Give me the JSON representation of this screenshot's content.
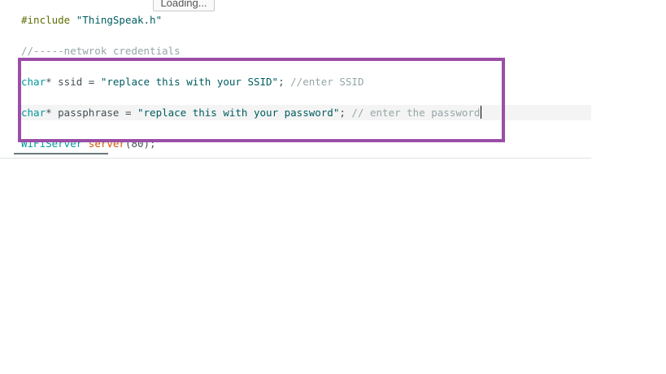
{
  "tooltip": {
    "text": "Loading..."
  },
  "code": {
    "include": {
      "directive": "#include",
      "file": "\"ThingSpeak.h\""
    },
    "comment_credentials": "//-----netwrok credentials",
    "ssid_line": {
      "type": "char",
      "rest": "* ssid = ",
      "value": "\"replace this with your SSID\"",
      "semicolon": "; ",
      "comment": "//enter SSID"
    },
    "pass_line": {
      "type": "char",
      "rest": "* passphrase = ",
      "value": "\"replace this with your password\"",
      "semicolon": "; ",
      "comment": "// enter the password"
    },
    "server_line": {
      "type": "WiFiServer",
      "space": " ",
      "name": "server",
      "args": "(80);"
    }
  },
  "colors": {
    "highlight_border": "#9b4ea6",
    "keyword": "#00979c",
    "string": "#005c5f",
    "comment": "#95a5a6"
  }
}
